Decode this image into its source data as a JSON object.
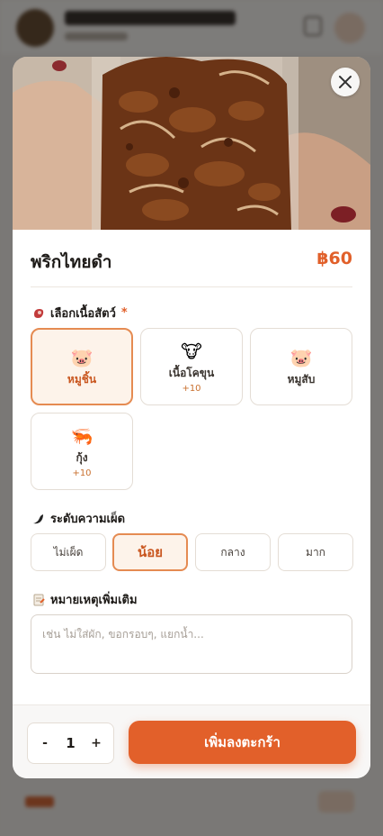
{
  "item": {
    "name": "พริกไทยดำ",
    "price": "฿60"
  },
  "meat_section": {
    "title": "เลือกเนื้อสัตว์",
    "required_mark": "*",
    "options": [
      {
        "emoji": "🐷",
        "label": "หมูชิ้น",
        "extra": "",
        "selected": true
      },
      {
        "emoji": "🐮",
        "label": "เนื้อโคขุน",
        "extra": "+10",
        "selected": false
      },
      {
        "emoji": "🐷",
        "label": "หมูสับ",
        "extra": "",
        "selected": false
      },
      {
        "emoji": "🦐",
        "label": "กุ้ง",
        "extra": "+10",
        "selected": false
      }
    ]
  },
  "spice_section": {
    "title": "ระดับความเผ็ด",
    "options": [
      {
        "label": "ไม่เผ็ด",
        "selected": false
      },
      {
        "label": "น้อย",
        "selected": true
      },
      {
        "label": "กลาง",
        "selected": false
      },
      {
        "label": "มาก",
        "selected": false
      }
    ]
  },
  "note_section": {
    "title": "หมายเหตุเพิ่มเติม",
    "placeholder": "เช่น ไม่ใส่ผัก, ขอกรอบๆ, แยกน้ำ...",
    "value": ""
  },
  "footer": {
    "minus": "-",
    "quantity": "1",
    "plus": "+",
    "add_to_cart": "เพิ่มลงตะกร้า"
  },
  "colors": {
    "accent": "#e2602a",
    "selected_border": "#e58b52",
    "selected_bg": "#fdf3ea"
  },
  "icons": {
    "close": "close-icon",
    "meat": "meat-icon",
    "spice": "chili-icon",
    "note": "note-icon"
  }
}
